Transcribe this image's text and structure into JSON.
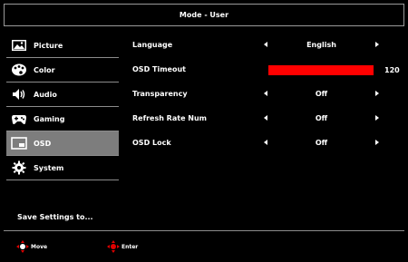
{
  "header": {
    "title": "Mode - User"
  },
  "sidebar": {
    "items": [
      {
        "label": "Picture",
        "icon": "picture-icon"
      },
      {
        "label": "Color",
        "icon": "palette-icon"
      },
      {
        "label": "Audio",
        "icon": "speaker-icon"
      },
      {
        "label": "Gaming",
        "icon": "gamepad-icon"
      },
      {
        "label": "OSD",
        "icon": "osd-icon",
        "selected": true
      },
      {
        "label": "System",
        "icon": "gear-icon"
      }
    ],
    "save_label": "Save Settings to..."
  },
  "settings": {
    "language": {
      "label": "Language",
      "value": "English"
    },
    "osd_timeout": {
      "label": "OSD Timeout",
      "value": "120",
      "fill_fraction": 1.0
    },
    "transparency": {
      "label": "Transparency",
      "value": "Off"
    },
    "refresh_rate_num": {
      "label": "Refresh Rate Num",
      "value": "Off"
    },
    "osd_lock": {
      "label": "OSD Lock",
      "value": "Off"
    }
  },
  "footer": {
    "move_label": "Move",
    "enter_label": "Enter"
  },
  "colors": {
    "background": "#000000",
    "selected_item": "#7d7d7d",
    "slider_fill": "#ff0000",
    "border": "#9a9a9a"
  }
}
